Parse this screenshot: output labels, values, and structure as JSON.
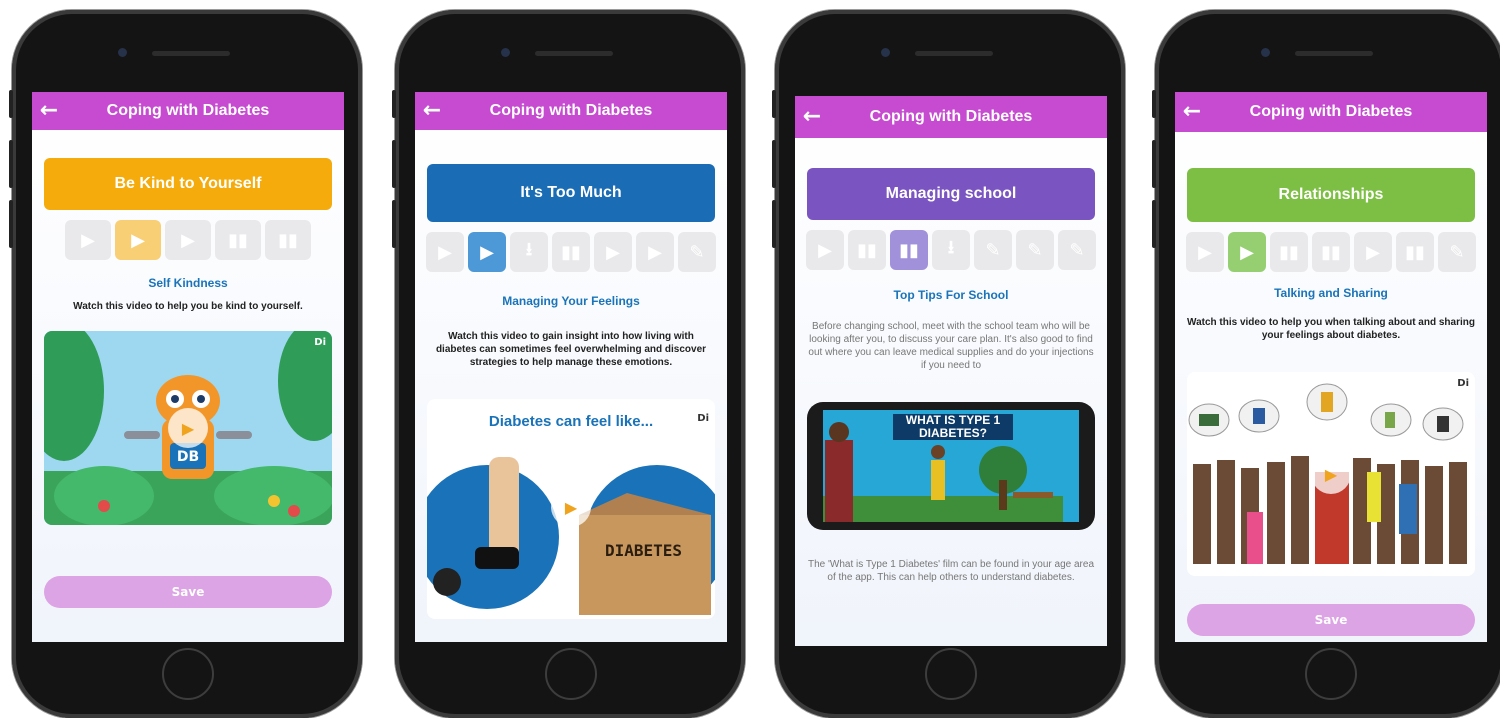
{
  "app_title": "Coping with Diabetes",
  "back_glyph": "←",
  "brand_mark": "Di",
  "phones": [
    {
      "banner": "Be Kind to Yourself",
      "banner_color": "#f4ab0b",
      "subtitle": "Self Kindness",
      "description": "Watch this video to help you be kind to yourself.",
      "media_caption": "DB",
      "save_label": "Save",
      "active_step": 2
    },
    {
      "banner": "It's Too Much",
      "banner_color": "#1a6db5",
      "subtitle": "Managing Your Feelings",
      "description": "Watch this video to gain insight into how living with diabetes can sometimes feel overwhelming and discover strategies to help manage these emotions.",
      "media_heading": "Diabetes can feel like...",
      "media_caption": "DIABETES",
      "active_step": 2
    },
    {
      "banner": "Managing school",
      "banner_color": "#7a55c2",
      "subtitle": "Top Tips For School",
      "description": "Before changing school, meet with the school team who will be looking after you, to discuss your care plan. It's also good to find out where you can leave medical supplies and do your injections if you need to",
      "media_heading": "WHAT IS TYPE 1 DIABETES?",
      "footnote": "The 'What is Type 1 Diabetes' film can be found in your age area of the app. This can help others to understand diabetes.",
      "active_step": 3
    },
    {
      "banner": "Relationships",
      "banner_color": "#7dbf44",
      "subtitle": "Talking and Sharing",
      "description": "Watch this video to help you when talking about and sharing your feelings about diabetes.",
      "save_label": "Save",
      "active_step": 2
    }
  ]
}
